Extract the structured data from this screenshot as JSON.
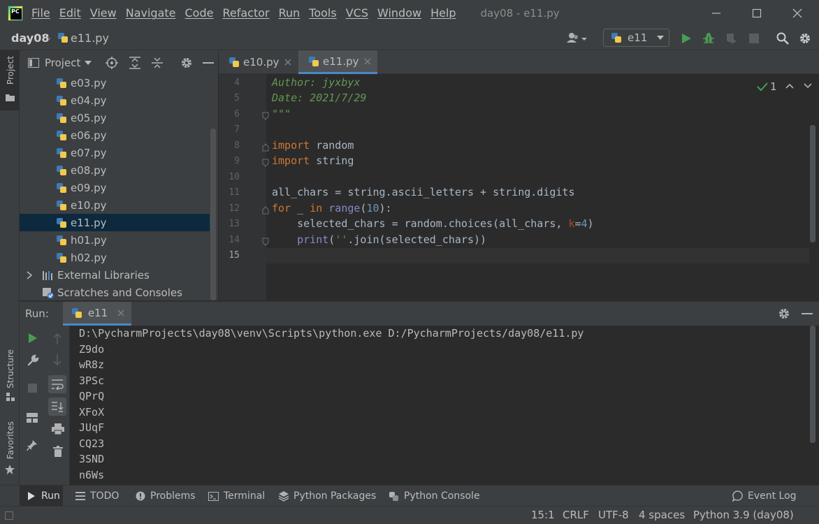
{
  "app": {
    "logo_text": "PC",
    "menu": [
      "File",
      "Edit",
      "View",
      "Navigate",
      "Code",
      "Refactor",
      "Run",
      "Tools",
      "VCS",
      "Window",
      "Help"
    ],
    "window_title": "day08 - e11.py"
  },
  "breadcrumb": {
    "project": "day08",
    "file": "e11.py"
  },
  "run_config": {
    "name": "e11"
  },
  "sidebar": {
    "project_tab": "Project",
    "structure_tab": "Structure",
    "favorites_tab": "Favorites"
  },
  "project_panel": {
    "title": "Project",
    "files": [
      "e03.py",
      "e04.py",
      "e05.py",
      "e06.py",
      "e07.py",
      "e08.py",
      "e09.py",
      "e10.py",
      "e11.py",
      "h01.py",
      "h02.py"
    ],
    "selected": "e11.py",
    "external_libraries": "External Libraries",
    "scratches": "Scratches and Consoles"
  },
  "editor": {
    "tabs": [
      {
        "label": "e10.py",
        "active": false
      },
      {
        "label": "e11.py",
        "active": true
      }
    ],
    "inspection_count": "1",
    "line_numbers": [
      "4",
      "5",
      "6",
      "7",
      "8",
      "9",
      "10",
      "11",
      "12",
      "13",
      "14",
      "15"
    ],
    "lines": {
      "l4": "Author: jyxbyx",
      "l5": "Date: 2021/7/29",
      "l6": "\"\"\"",
      "l8_kw": "import",
      "l8_rest": " random",
      "l9_kw": "import",
      "l9_rest": " string",
      "l11": "all_chars = string.ascii_letters + string.digits",
      "l12_for": "for",
      "l12_mid": " _ ",
      "l12_in": "in",
      "l12_sp": " ",
      "l12_range": "range",
      "l12_open": "(",
      "l12_num": "10",
      "l12_close": "):",
      "l13_a": "    selected_chars = random.choices(all_chars, ",
      "l13_k": "k",
      "l13_eq": "=",
      "l13_num": "4",
      "l13_close": ")",
      "l14_indent": "    ",
      "l14_print": "print",
      "l14_open": "(",
      "l14_str": "''",
      "l14_rest": ".join(selected_chars))"
    }
  },
  "run_panel": {
    "label": "Run:",
    "tab": "e11",
    "output": [
      "D:\\PycharmProjects\\day08\\venv\\Scripts\\python.exe D:/PycharmProjects/day08/e11.py",
      "Z9do",
      "wR8z",
      "3PSc",
      "QPrQ",
      "XFoX",
      "JUqF",
      "CQ23",
      "3SND",
      "n6Ws"
    ]
  },
  "bottom_tabs": [
    "Run",
    "TODO",
    "Problems",
    "Terminal",
    "Python Packages",
    "Python Console"
  ],
  "event_log": "Event Log",
  "status": {
    "position": "15:1",
    "line_sep": "CRLF",
    "encoding": "UTF-8",
    "indent": "4 spaces",
    "interpreter": "Python 3.9 (day08)"
  },
  "colors": {
    "accent": "#4a88c7",
    "run_green": "#499c54",
    "selection": "#0d293e",
    "keyword": "#cc7832",
    "comment": "#629755"
  }
}
